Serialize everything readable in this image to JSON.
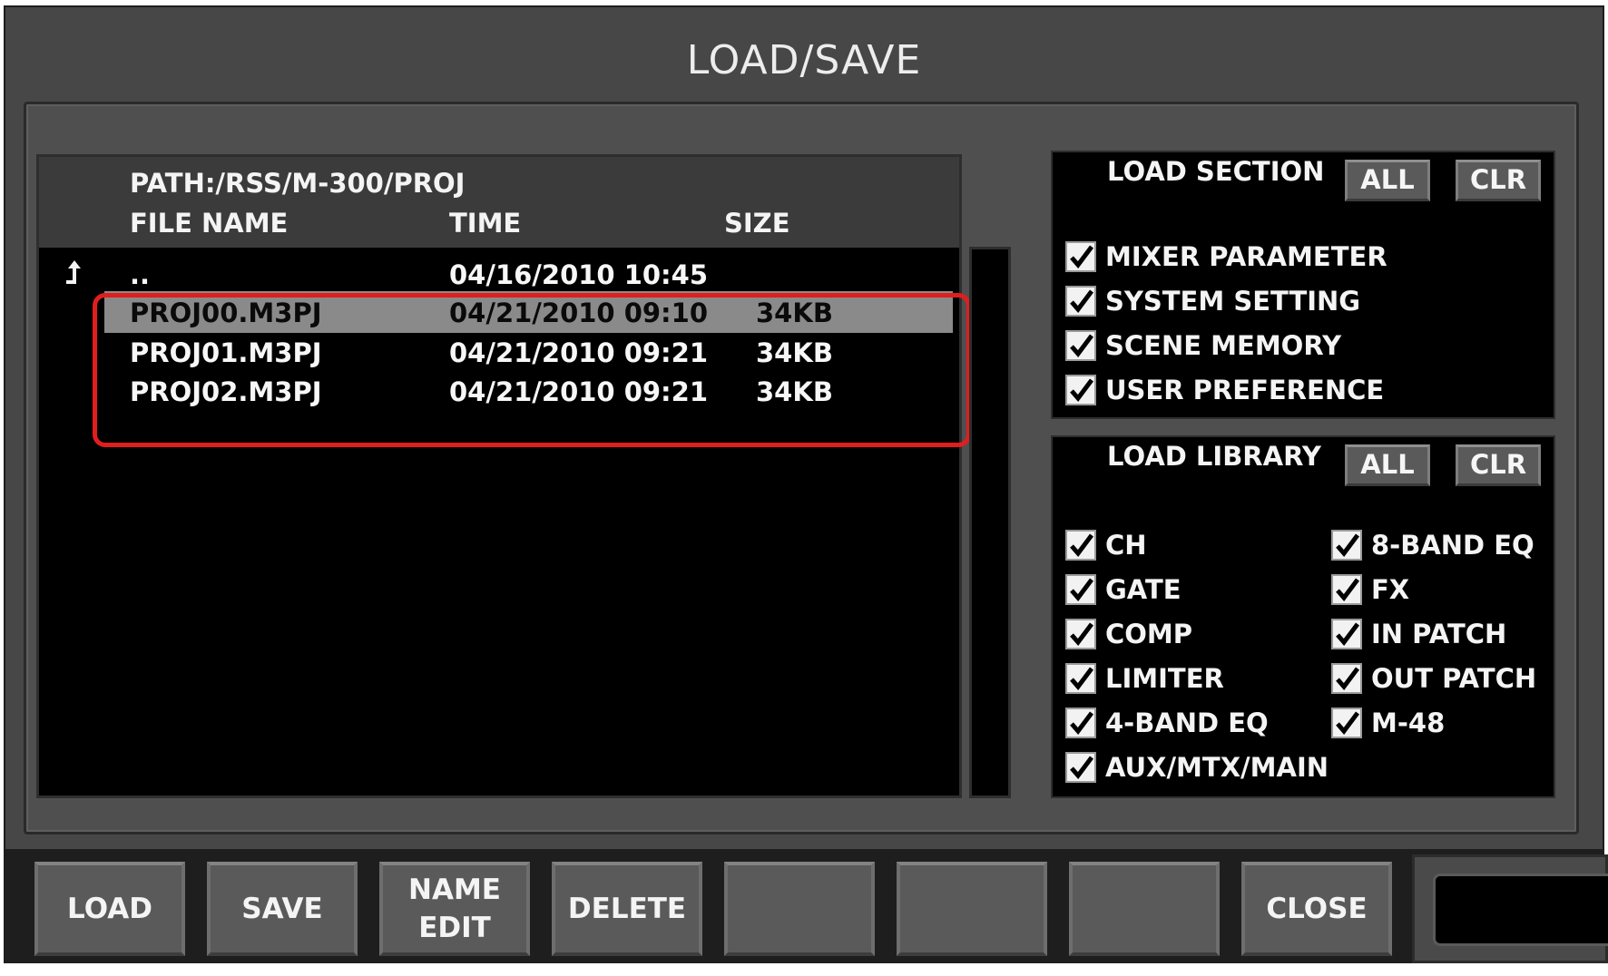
{
  "window": {
    "title": "LOAD/SAVE"
  },
  "browser": {
    "path": "PATH:/RSS/M-300/PROJ",
    "columns": {
      "file_name": "FILE NAME",
      "time": "TIME",
      "size": "SIZE"
    },
    "parent_row": {
      "name": "..",
      "time": "04/16/2010 10:45",
      "size": ""
    },
    "files": [
      {
        "name": "PROJ00.M3PJ",
        "time": "04/21/2010 09:10",
        "size": "34KB",
        "selected": true
      },
      {
        "name": "PROJ01.M3PJ",
        "time": "04/21/2010 09:21",
        "size": "34KB",
        "selected": false
      },
      {
        "name": "PROJ02.M3PJ",
        "time": "04/21/2010 09:21",
        "size": "34KB",
        "selected": false
      }
    ],
    "highlight_color": "#e01e1e"
  },
  "load_section": {
    "title": "LOAD SECTION",
    "all_label": "ALL",
    "clr_label": "CLR",
    "items": [
      {
        "label": "MIXER PARAMETER",
        "checked": true
      },
      {
        "label": "SYSTEM SETTING",
        "checked": true
      },
      {
        "label": "SCENE MEMORY",
        "checked": true
      },
      {
        "label": "USER PREFERENCE",
        "checked": true
      }
    ]
  },
  "load_library": {
    "title": "LOAD LIBRARY",
    "all_label": "ALL",
    "clr_label": "CLR",
    "left_items": [
      {
        "label": "CH",
        "checked": true
      },
      {
        "label": "GATE",
        "checked": true
      },
      {
        "label": "COMP",
        "checked": true
      },
      {
        "label": "LIMITER",
        "checked": true
      },
      {
        "label": "4-BAND EQ",
        "checked": true
      },
      {
        "label": "AUX/MTX/MAIN",
        "checked": true
      }
    ],
    "right_items": [
      {
        "label": "8-BAND EQ",
        "checked": true
      },
      {
        "label": "FX",
        "checked": true
      },
      {
        "label": "IN PATCH",
        "checked": true
      },
      {
        "label": "OUT PATCH",
        "checked": true
      },
      {
        "label": "M-48",
        "checked": true
      }
    ]
  },
  "function_buttons": {
    "load": "LOAD",
    "save": "SAVE",
    "name_edit_line1": "NAME",
    "name_edit_line2": "EDIT",
    "delete": "DELETE",
    "blank1": "",
    "blank2": "",
    "blank3": "",
    "close": "CLOSE"
  },
  "icons": {
    "parent_dir": "up-arrow-icon",
    "checkbox": "checkmark-icon"
  }
}
